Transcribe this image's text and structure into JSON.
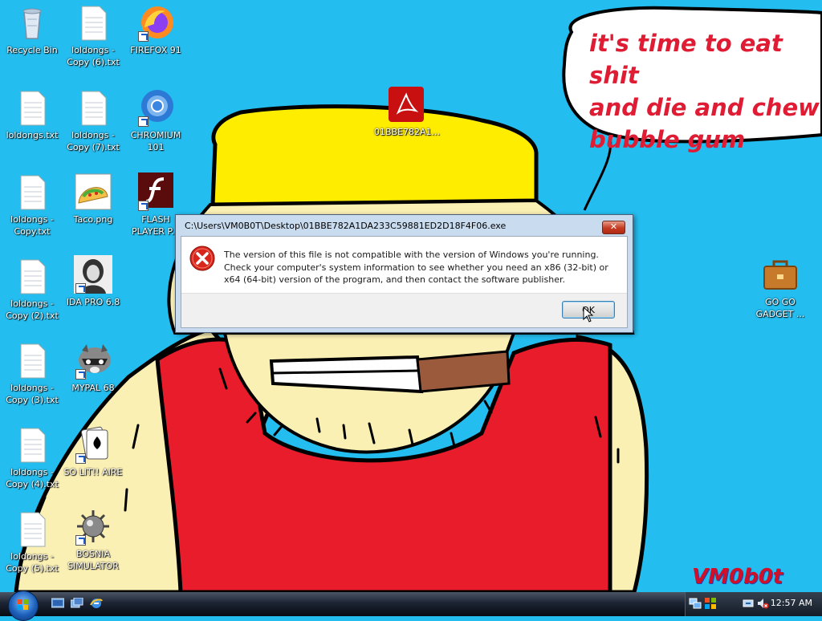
{
  "desktop": {
    "bubble_text": "it's time to eat shit\nand die and chew\nbubble gum",
    "signature": "VM0b0t",
    "icons": [
      {
        "label": "Recycle Bin",
        "icon": "recycle-bin-icon"
      },
      {
        "label": "loldongs -\nCopy (6).txt",
        "icon": "text-file-icon"
      },
      {
        "label": "FIREFOX 91",
        "icon": "firefox-icon"
      },
      {
        "label": "loldongs.txt",
        "icon": "text-file-icon"
      },
      {
        "label": "loldongs -\nCopy (7).txt",
        "icon": "text-file-icon"
      },
      {
        "label": "CHROMIUM\n101",
        "icon": "chromium-icon"
      },
      {
        "label": "01BBE782A1...",
        "icon": "pdf-icon"
      },
      {
        "label": "loldongs -\nCopy.txt",
        "icon": "text-file-icon"
      },
      {
        "label": "Taco.png",
        "icon": "taco-icon"
      },
      {
        "label": "FLASH\nPLAYER P...",
        "icon": "flash-icon"
      },
      {
        "label": "loldongs -\nCopy (2).txt",
        "icon": "text-file-icon"
      },
      {
        "label": "IDA PRO 6.8",
        "icon": "ida-pro-icon"
      },
      {
        "label": "GO GO\nGADGET ...",
        "icon": "briefcase-icon"
      },
      {
        "label": "loldongs -\nCopy (3).txt",
        "icon": "text-file-icon"
      },
      {
        "label": "MYPAL 68",
        "icon": "raccoon-icon"
      },
      {
        "label": "loldongs -\nCopy (4).txt",
        "icon": "text-file-icon"
      },
      {
        "label": "SO LIT!! AIRE",
        "icon": "solitaire-icon"
      },
      {
        "label": "loldongs -\nCopy (5).txt",
        "icon": "text-file-icon"
      },
      {
        "label": "BOSNIA\nSIMULATOR",
        "icon": "mine-icon"
      }
    ]
  },
  "dialog": {
    "title": "C:\\Users\\VM0B0T\\Desktop\\01BBE782A1DA233C59881ED2D18F4F06.exe",
    "message": "The version of this file is not compatible with the version of Windows you're running. Check your computer's system information to see whether you need an x86 (32-bit) or x64 (64-bit) version of the program, and then contact the software publisher.",
    "ok_label": "OK",
    "close_label": "✕"
  },
  "taskbar": {
    "clock": "12:57 AM",
    "quick_launch": [
      "show-desktop-icon",
      "switch-windows-icon",
      "internet-explorer-icon"
    ],
    "tray": [
      "network-icon",
      "security-icon",
      "safely-remove-icon",
      "volume-muted-icon"
    ]
  },
  "colors": {
    "desktop_bg": "#24bdf0",
    "bubble_text": "#e01c34",
    "hat": "#ffed00",
    "shirt": "#e81c2a",
    "skin": "#fbf0b4"
  }
}
